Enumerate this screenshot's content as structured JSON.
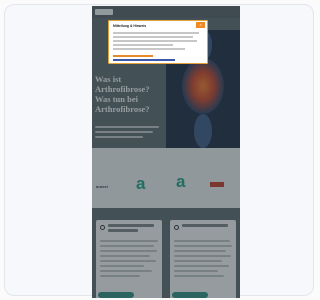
{
  "page": {
    "hero": {
      "title": "Was ist Arthrofibrose? Was tun bei Arthrofibrose?"
    },
    "brands": {
      "logo_text": "araxxt",
      "mark": "a"
    },
    "consent": {
      "title": "Mitteilung & Hinweis",
      "close": "×"
    },
    "colors": {
      "teal": "#2f8d84",
      "orange": "#f08a24",
      "dark": "#596970"
    },
    "icons": [
      "search-icon",
      "shield-icon",
      "close-icon"
    ]
  }
}
